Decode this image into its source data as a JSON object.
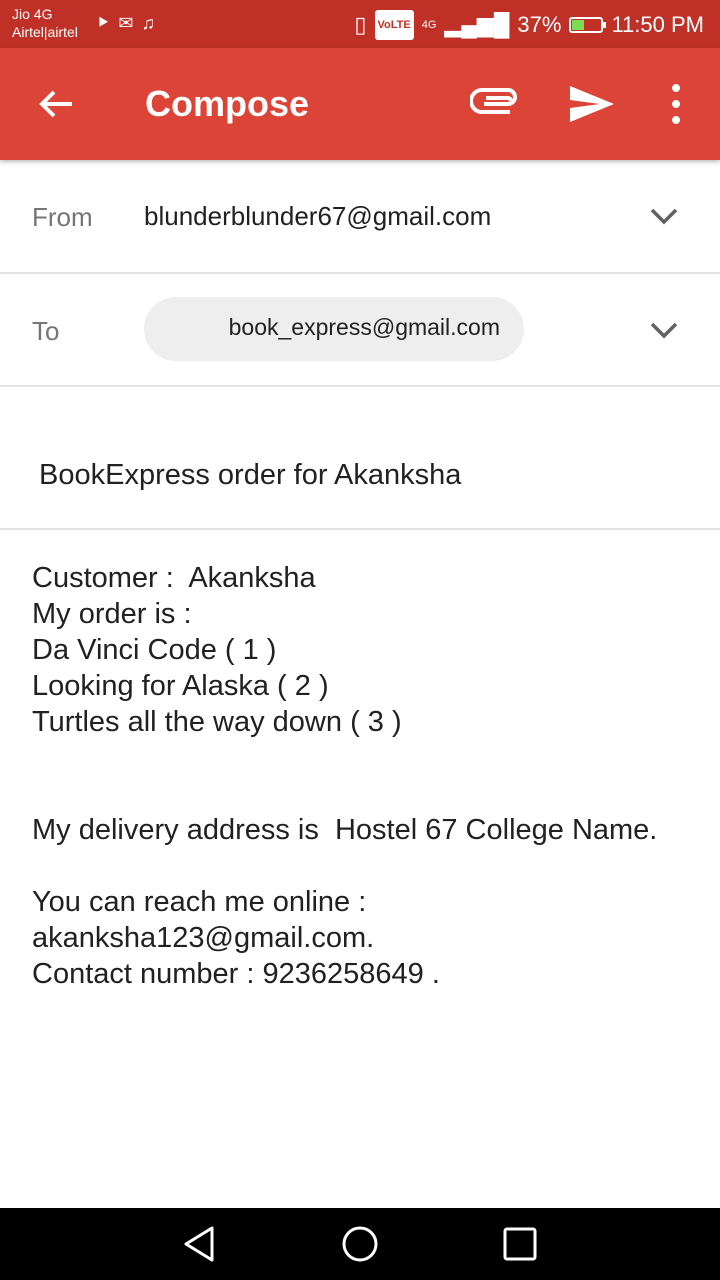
{
  "status_bar": {
    "carrier_line1": "Jio 4G",
    "carrier_line2": "Airtel|airtel",
    "volte": "VoLTE",
    "network": "4G",
    "battery_percent": "37%",
    "battery_level": 0.37,
    "time": "11:50 PM",
    "icons": [
      "notification-icon-1",
      "gmail-icon",
      "music-icon",
      "vibrate-icon",
      "signal-icon",
      "battery-icon"
    ]
  },
  "app_bar": {
    "title": "Compose",
    "color": "#db4437",
    "icons": [
      "back-arrow-icon",
      "attachment-icon",
      "send-icon",
      "more-vert-icon"
    ]
  },
  "from": {
    "label": "From",
    "value": "blunderblunder67@gmail.com"
  },
  "to": {
    "label": "To",
    "recipient": "book_express@gmail.com"
  },
  "subject": "BookExpress order for Akanksha",
  "body": {
    "lines": [
      "Customer :  Akanksha",
      "My order is :",
      "Da Vinci Code ( 1 )",
      "Looking for Alaska ( 2 )",
      "Turtles all the way down ( 3 )",
      "",
      "",
      "My delivery address is  Hostel 67 College Name.",
      "",
      "You can reach me online :",
      "akanksha123@gmail.com.",
      "Contact number : 9236258649 ."
    ]
  },
  "nav_bar": {
    "icons": [
      "nav-back-icon",
      "nav-home-icon",
      "nav-recents-icon"
    ]
  }
}
